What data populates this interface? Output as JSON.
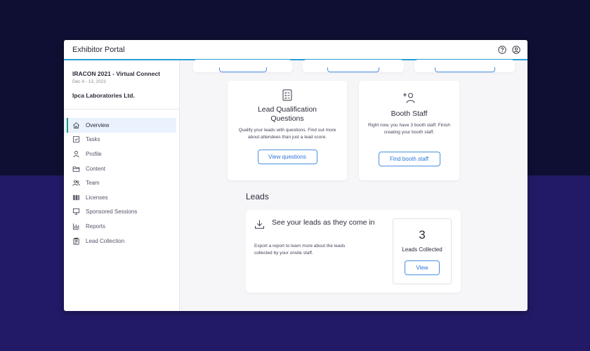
{
  "app": {
    "title": "Exhibitor Portal"
  },
  "header_icons": [
    "help-circle-icon",
    "user-circle-icon"
  ],
  "sidebar": {
    "event_name": "IRACON 2021 - Virtual Connect",
    "event_dates": "Dec 4 - 13, 2021",
    "company": "Ipca Laboratories Ltd.",
    "items": [
      {
        "label": "Overview",
        "icon": "home-icon",
        "active": true
      },
      {
        "label": "Tasks",
        "icon": "checkbox-icon",
        "active": false
      },
      {
        "label": "Profile",
        "icon": "person-icon",
        "active": false
      },
      {
        "label": "Content",
        "icon": "folder-icon",
        "active": false
      },
      {
        "label": "Team",
        "icon": "people-icon",
        "active": false
      },
      {
        "label": "Licenses",
        "icon": "barcode-icon",
        "active": false
      },
      {
        "label": "Sponsored Sessions",
        "icon": "presentation-icon",
        "active": false
      },
      {
        "label": "Reports",
        "icon": "bar-chart-icon",
        "active": false
      },
      {
        "label": "Lead Collection",
        "icon": "clipboard-icon",
        "active": false
      }
    ]
  },
  "cards": {
    "lead_qualification": {
      "title": "Lead Qualification Questions",
      "description": "Qualify your leads with questions. Find out more about attendees than just a lead score.",
      "button": "View questions",
      "icon": "checklist-icon"
    },
    "booth_staff": {
      "title": "Booth Staff",
      "description": "Right now, you have 3 booth staff. Finish creating your booth staff.",
      "button": "Find booth staff",
      "icon": "add-person-icon"
    }
  },
  "leads": {
    "heading": "Leads",
    "title": "See your leads as they come in",
    "description": "Export a report to learn more about the leads collected by your onsite staff.",
    "count": "3",
    "count_label": "Leads Collected",
    "button": "View",
    "icon": "download-icon"
  },
  "colors": {
    "accent": "#2a9fd6",
    "button_border": "#4a8fe0",
    "active_indicator": "#1b9e7a",
    "background_top": "#0f0f33",
    "background_bottom": "#221a66"
  }
}
